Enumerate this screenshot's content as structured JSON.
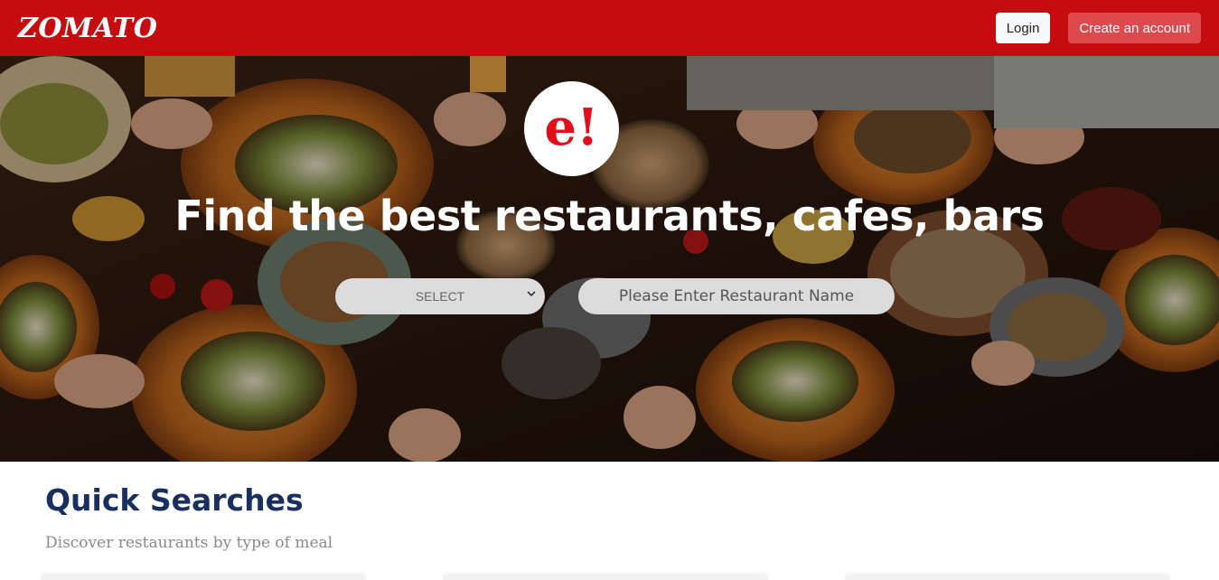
{
  "navbar": {
    "brand": "ZOMATO",
    "login_label": "Login",
    "create_account_label": "Create an account"
  },
  "hero": {
    "logo_text": "e!",
    "title": "Find the best restaurants, cafes, bars",
    "location_select": {
      "selected": "SELECT"
    },
    "restaurant_search": {
      "placeholder": "Please Enter Restaurant Name",
      "value": ""
    }
  },
  "quick_searches": {
    "title": "Quick Searches",
    "subtitle": "Discover restaurants by type of meal"
  },
  "colors": {
    "brand_red": "#c50c10",
    "logo_red": "#e0101a",
    "heading_navy": "#192f60"
  },
  "icons": {
    "select_caret": "chevron-down-icon"
  }
}
